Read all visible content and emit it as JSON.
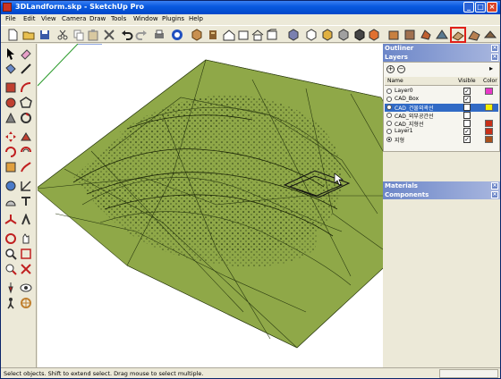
{
  "window": {
    "title": "3DLandform.skp - SketchUp Pro"
  },
  "menu": [
    "File",
    "Edit",
    "View",
    "Camera",
    "Draw",
    "Tools",
    "Window",
    "Plugins",
    "Help"
  ],
  "toolbar": {
    "icons": [
      "new-icon",
      "open-icon",
      "save-icon",
      "cut-icon",
      "copy-icon",
      "paste-icon",
      "erase-icon",
      "undo-icon",
      "redo-icon",
      "print-icon",
      "model-info-icon",
      "make-component-icon",
      "sandbox-icon",
      "house-icon",
      "front-icon",
      "back-icon",
      "left-icon",
      "iso-icon",
      "top-view-icon",
      "right-view-icon",
      "bottom-view-icon",
      "xray-icon",
      "wireframe-icon",
      "hidden-line-icon",
      "shaded-icon",
      "textured-icon",
      "monochrome-icon",
      "from-contours-icon",
      "from-scratch-icon"
    ],
    "highlighted": "from-contours-icon"
  },
  "left_tools": [
    "select-icon",
    "eraser-icon",
    "paint-icon",
    "line-icon",
    "rectangle-icon",
    "arc-icon",
    "circle-icon",
    "polygon-icon",
    "move-icon",
    "pushpull-icon",
    "rotate-icon",
    "followme-icon",
    "scale-icon",
    "offset-icon",
    "tape-icon",
    "dimension-icon",
    "protractor-icon",
    "text-icon",
    "axes-icon",
    "3dtext-icon",
    "orbit-icon",
    "pan-icon",
    "zoom-icon",
    "zoom-window-icon",
    "zoom-extents-icon",
    "previous-icon",
    "walk-icon",
    "look-around-icon",
    "position-camera-icon",
    "section-icon"
  ],
  "panels": {
    "outliner": {
      "title": "Outliner"
    },
    "layers": {
      "title": "Layers",
      "columns": {
        "name": "Name",
        "visible": "Visible",
        "color": "Color"
      },
      "rows": [
        {
          "name": "Layer0",
          "visible": true,
          "color": "#e838c8",
          "selected": false,
          "active": false
        },
        {
          "name": "CAD_Box",
          "visible": true,
          "color": "",
          "selected": false,
          "active": false
        },
        {
          "name": "CAD_건물외곽선",
          "visible": false,
          "color": "#f4f000",
          "selected": true,
          "active": false
        },
        {
          "name": "CAD_외부공간선",
          "visible": false,
          "color": "",
          "selected": false,
          "active": false
        },
        {
          "name": "CAD_지형선",
          "visible": false,
          "color": "#c83018",
          "selected": false,
          "active": false
        },
        {
          "name": "Layer1",
          "visible": true,
          "color": "#c83018",
          "selected": false,
          "active": false
        },
        {
          "name": "지형",
          "visible": true,
          "color": "#a8501c",
          "selected": false,
          "active": true
        }
      ]
    },
    "materials": {
      "title": "Materials"
    },
    "components": {
      "title": "Components"
    }
  },
  "statusbar": {
    "text": "Select objects. Shift to extend select. Drag mouse to select multiple."
  },
  "colors": {
    "terrain": "#8fa848",
    "terrain_dark": "#6c8a30",
    "titlebar": "#0a5ae0",
    "selection": "#316ac5"
  }
}
